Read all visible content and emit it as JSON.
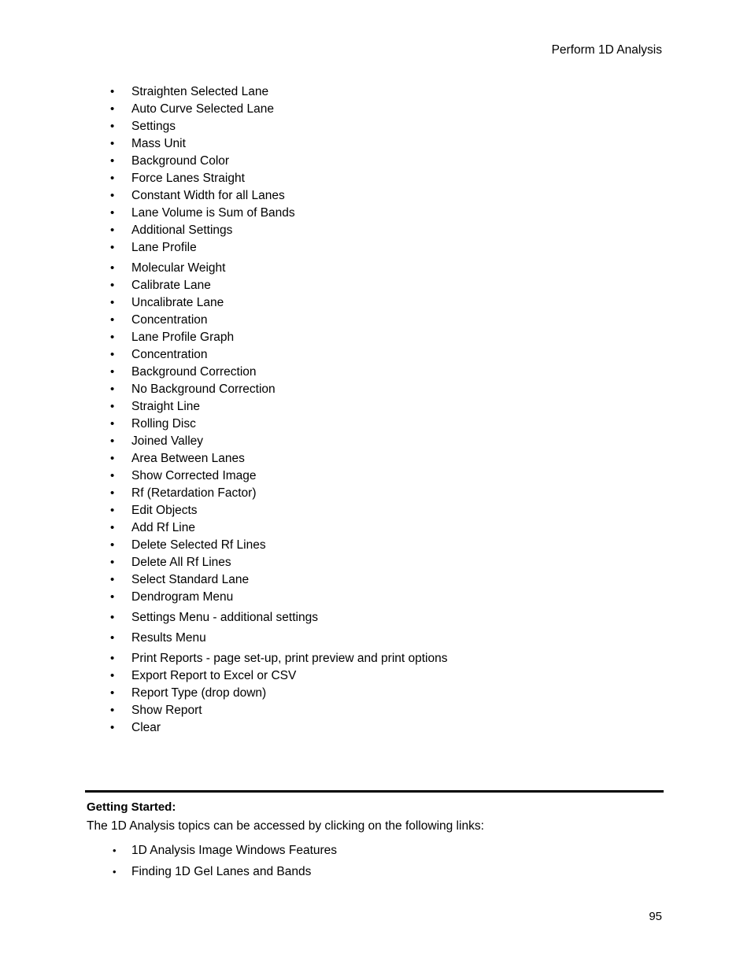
{
  "page": {
    "running_header": "Perform 1D Analysis",
    "page_number": "95",
    "bullet_glyph": "•"
  },
  "main_list": {
    "items": [
      {
        "label": "Straighten Selected Lane",
        "gap_before": false
      },
      {
        "label": "Auto Curve Selected Lane",
        "gap_before": false
      },
      {
        "label": "Settings",
        "gap_before": false
      },
      {
        "label": "Mass Unit",
        "gap_before": false
      },
      {
        "label": "Background Color",
        "gap_before": false
      },
      {
        "label": "Force Lanes Straight",
        "gap_before": false
      },
      {
        "label": "Constant Width for all Lanes",
        "gap_before": false
      },
      {
        "label": "Lane Volume is Sum of Bands",
        "gap_before": false
      },
      {
        "label": "Additional Settings",
        "gap_before": false
      },
      {
        "label": "Lane Profile",
        "gap_before": false
      },
      {
        "label": "Molecular Weight",
        "gap_before": true
      },
      {
        "label": "Calibrate Lane",
        "gap_before": false
      },
      {
        "label": "Uncalibrate Lane",
        "gap_before": false
      },
      {
        "label": "Concentration",
        "gap_before": false
      },
      {
        "label": "Lane Profile Graph",
        "gap_before": false
      },
      {
        "label": "Concentration",
        "gap_before": false
      },
      {
        "label": "Background Correction",
        "gap_before": false
      },
      {
        "label": "No Background Correction",
        "gap_before": false
      },
      {
        "label": "Straight Line",
        "gap_before": false
      },
      {
        "label": "Rolling Disc",
        "gap_before": false
      },
      {
        "label": "Joined Valley",
        "gap_before": false
      },
      {
        "label": "Area Between Lanes",
        "gap_before": false
      },
      {
        "label": "Show Corrected Image",
        "gap_before": false
      },
      {
        "label": "Rf (Retardation Factor)",
        "gap_before": false
      },
      {
        "label": "Edit Objects",
        "gap_before": false
      },
      {
        "label": "Add Rf Line",
        "gap_before": false
      },
      {
        "label": "Delete Selected Rf Lines",
        "gap_before": false
      },
      {
        "label": "Delete All Rf Lines",
        "gap_before": false
      },
      {
        "label": "Select Standard Lane",
        "gap_before": false
      },
      {
        "label": "Dendrogram Menu",
        "gap_before": false
      },
      {
        "label": "Settings Menu - additional settings",
        "gap_before": true
      },
      {
        "label": "Results Menu",
        "gap_before": true
      },
      {
        "label": "Print Reports - page set-up, print preview and print options",
        "gap_before": true
      },
      {
        "label": "Export Report to Excel or CSV",
        "gap_before": false
      },
      {
        "label": "Report Type (drop down)",
        "gap_before": false
      },
      {
        "label": "Show Report",
        "gap_before": false
      },
      {
        "label": "Clear",
        "gap_before": false
      }
    ]
  },
  "getting_started": {
    "heading": "Getting Started:",
    "intro": "The 1D Analysis topics can be accessed by clicking on the following links:",
    "links": [
      {
        "label": "1D Analysis Image Windows Features"
      },
      {
        "label": "Finding 1D Gel Lanes and Bands"
      }
    ]
  }
}
